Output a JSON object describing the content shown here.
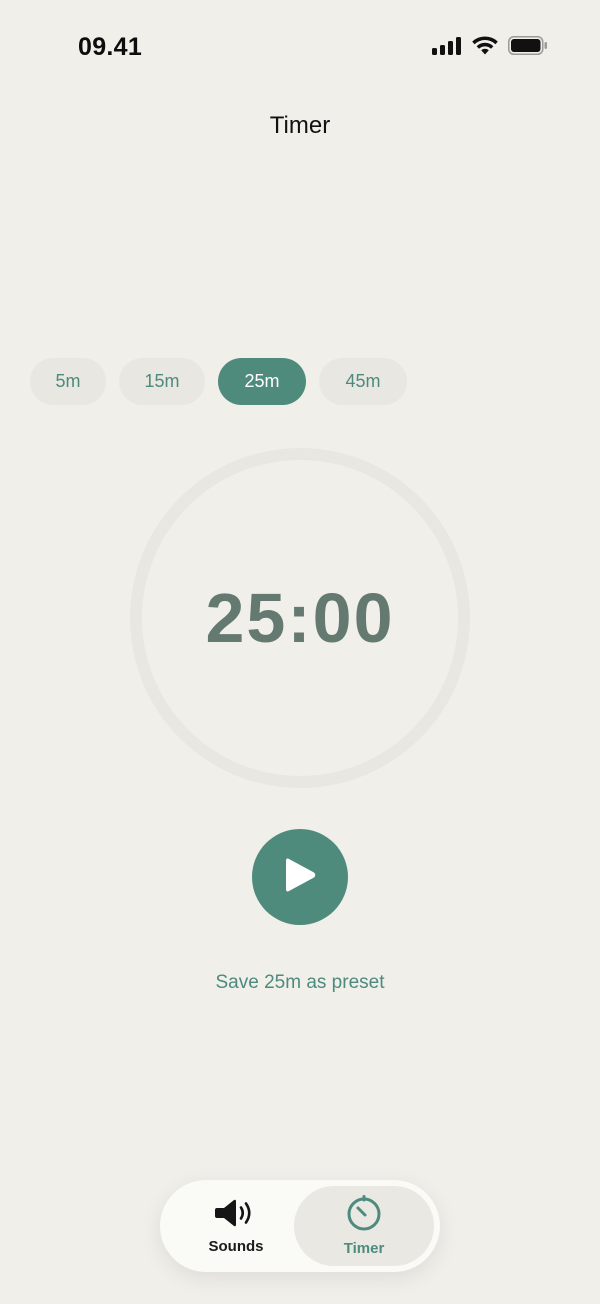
{
  "status_bar": {
    "time": "09.41",
    "icons": [
      "signal-icon",
      "wifi-icon",
      "battery-icon"
    ]
  },
  "header": {
    "title": "Timer"
  },
  "presets": {
    "options": [
      "5m",
      "15m",
      "25m",
      "45m"
    ],
    "selected": "25m"
  },
  "timer": {
    "display": "25:00",
    "progress": 0
  },
  "play_button": {
    "icon": "play-icon"
  },
  "save_preset": {
    "label": "Save 25m as preset"
  },
  "tab_bar": {
    "tabs": [
      {
        "label": "Sounds",
        "icon": "speaker-icon",
        "active": false
      },
      {
        "label": "Timer",
        "icon": "timer-icon",
        "active": true
      }
    ]
  },
  "colors": {
    "accent": "#4f8b7d",
    "background": "#f0efea",
    "chip_bg": "#e8e7e2",
    "timer_text": "#647a70"
  }
}
